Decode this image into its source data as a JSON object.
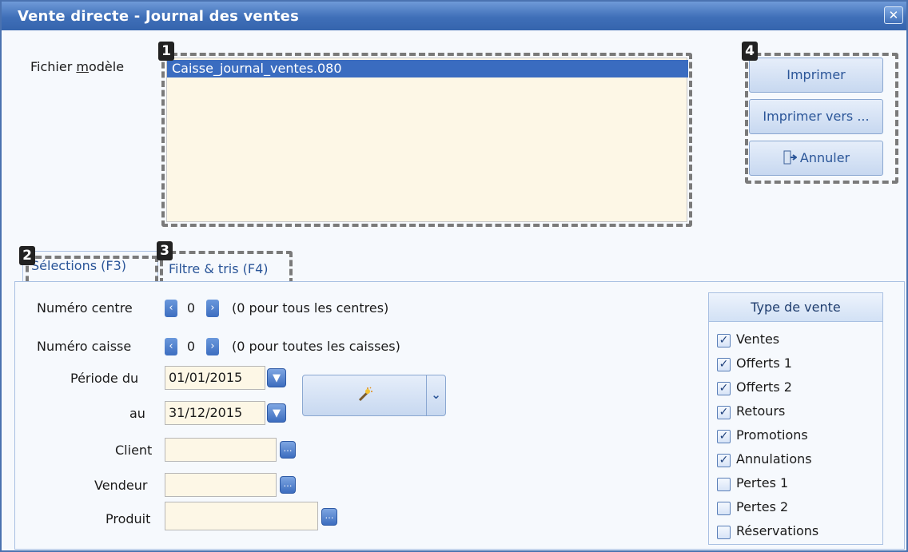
{
  "window": {
    "title": "Vente directe - Journal des ventes",
    "close_glyph": "✕"
  },
  "template": {
    "label_before": "Fichier ",
    "label_underlined": "m",
    "label_after": "odèle",
    "items": [
      "Caisse_journal_ventes.080"
    ]
  },
  "markers": [
    "1",
    "2",
    "3",
    "4"
  ],
  "actions": {
    "print": "Imprimer",
    "print_to": "Imprimer vers ...",
    "cancel": "Annuler"
  },
  "tabs": [
    "Sélections (F3)",
    "Filtre & tris (F4)"
  ],
  "selections": {
    "centre_label": "Numéro centre",
    "centre_value": "0",
    "centre_hint": "(0 pour tous les centres)",
    "caisse_label": "Numéro caisse",
    "caisse_value": "0",
    "caisse_hint": "(0 pour toutes les caisses)",
    "periode_label": "Période du",
    "periode_from": "01/01/2015",
    "au_label": "au",
    "periode_to": "31/12/2015",
    "client_label": "Client",
    "client_value": "",
    "vendeur_label": "Vendeur",
    "vendeur_value": "",
    "produit_label": "Produit",
    "produit_value": ""
  },
  "sale_types": {
    "title": "Type de vente",
    "items": [
      {
        "label": "Ventes",
        "checked": true
      },
      {
        "label": "Offerts 1",
        "checked": true
      },
      {
        "label": "Offerts 2",
        "checked": true
      },
      {
        "label": "Retours",
        "checked": true
      },
      {
        "label": "Promotions",
        "checked": true
      },
      {
        "label": "Annulations",
        "checked": true
      },
      {
        "label": "Pertes 1",
        "checked": false
      },
      {
        "label": "Pertes 2",
        "checked": false
      },
      {
        "label": "Réservations",
        "checked": false
      }
    ]
  },
  "icons": {
    "close": "close-icon",
    "cancel": "exit-door-icon",
    "wand": "magic-wand-icon",
    "dropdown": "chevron-down-icon",
    "ellipsis": "ellipsis-icon",
    "spin_left": "chevron-left-icon",
    "spin_right": "chevron-right-icon"
  },
  "colors": {
    "title_bar": "#3f6fb8",
    "selection": "#3a6cc0",
    "field_bg": "#fdf7e6",
    "link_text": "#2a5598"
  }
}
